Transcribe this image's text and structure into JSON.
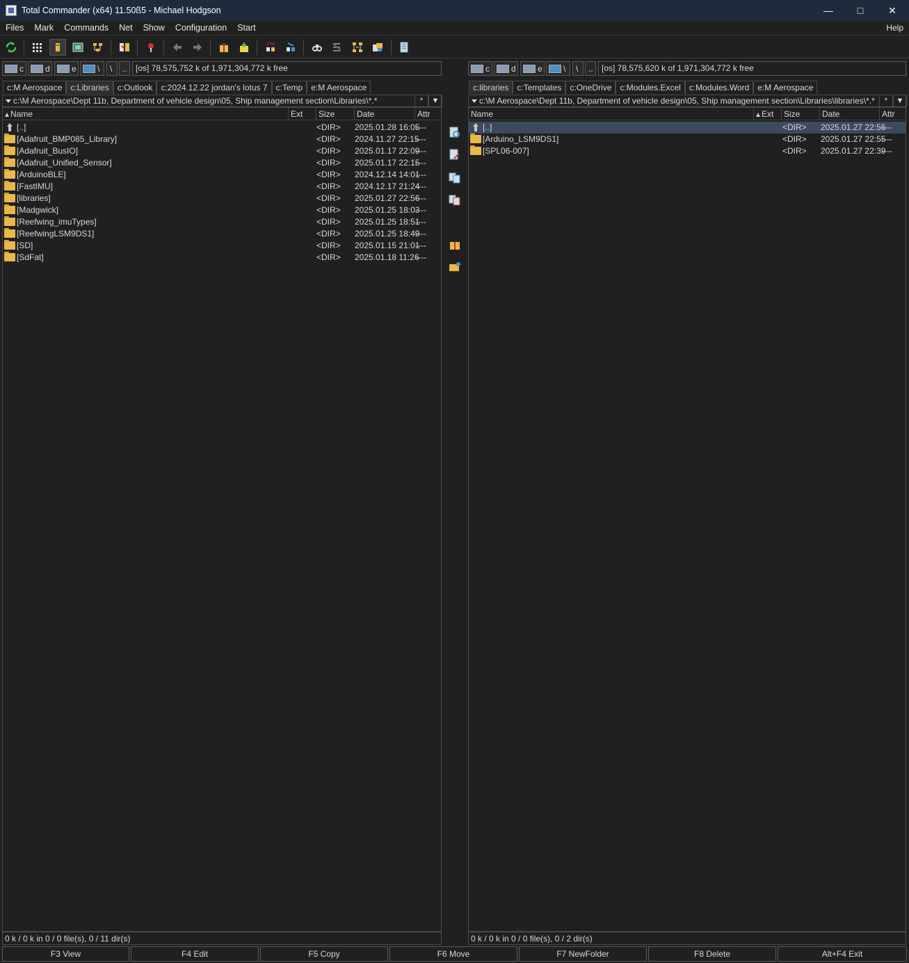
{
  "window": {
    "title": "Total Commander (x64) 11.50ß5 - Michael Hodgson",
    "minimize_glyph": "—",
    "maximize_glyph": "□",
    "close_glyph": "✕"
  },
  "menu": {
    "items": [
      "Files",
      "Mark",
      "Commands",
      "Net",
      "Show",
      "Configuration",
      "Start"
    ],
    "help": "Help"
  },
  "toolbar": {
    "icons": [
      "refresh-icon",
      "brief-view-icon",
      "detailed-view-icon",
      "thumbnails-icon",
      "tree-view-icon",
      "compare-dirs-icon",
      "multi-rename-icon",
      "back-icon",
      "forward-icon",
      "pack-icon",
      "unpack-icon",
      "ftp-connect-icon",
      "ftp-disconnect-icon",
      "find-icon",
      "sync-dirs-icon",
      "branch-view-icon",
      "copy-names-icon",
      "notepad-icon"
    ]
  },
  "left": {
    "drives": [
      {
        "letter": "c"
      },
      {
        "letter": "d"
      },
      {
        "letter": "e"
      },
      {
        "letter": "\\"
      }
    ],
    "root_label": "\\",
    "up_label": "..",
    "free_info": "[os]  78,575,752 k of 1,971,304,772 k free",
    "tabs": [
      "c:M Aerospace",
      "c:Libraries",
      "c:Outlook",
      "c:2024.12.22 jordan's lotus 7",
      "c:Temp",
      "e:M Aerospace"
    ],
    "active_tab": 1,
    "path": "c:\\M Aerospace\\Dept 11b, Department of vehicle design\\05, Ship management section\\Libraries\\*.*",
    "columns": {
      "name": "Name",
      "ext": "Ext",
      "size": "Size",
      "date": "Date",
      "attr": "Attr"
    },
    "rows": [
      {
        "name": "[..]",
        "size": "<DIR>",
        "date": "2025.01.28 16:05",
        "attr": "----",
        "up": true
      },
      {
        "name": "[Adafruit_BMP085_Library]",
        "size": "<DIR>",
        "date": "2024.11.27 22:15",
        "attr": "----"
      },
      {
        "name": "[Adafruit_BusIO]",
        "size": "<DIR>",
        "date": "2025.01.17 22:09",
        "attr": "----"
      },
      {
        "name": "[Adafruit_Unified_Sensor]",
        "size": "<DIR>",
        "date": "2025.01.17 22:15",
        "attr": "----"
      },
      {
        "name": "[ArduinoBLE]",
        "size": "<DIR>",
        "date": "2024.12.14 14:01",
        "attr": "----"
      },
      {
        "name": "[FastIMU]",
        "size": "<DIR>",
        "date": "2024.12.17 21:24",
        "attr": "----"
      },
      {
        "name": "[libraries]",
        "size": "<DIR>",
        "date": "2025.01.27 22:56",
        "attr": "----"
      },
      {
        "name": "[Madgwick]",
        "size": "<DIR>",
        "date": "2025.01.25 18:03",
        "attr": "----"
      },
      {
        "name": "[Reefwing_imuTypes]",
        "size": "<DIR>",
        "date": "2025.01.25 18:51",
        "attr": "----"
      },
      {
        "name": "[ReefwingLSM9DS1]",
        "size": "<DIR>",
        "date": "2025.01.25 18:49",
        "attr": "----"
      },
      {
        "name": "[SD]",
        "size": "<DIR>",
        "date": "2025.01.15 21:01",
        "attr": "----"
      },
      {
        "name": "[SdFat]",
        "size": "<DIR>",
        "date": "2025.01.18 11:26",
        "attr": "----"
      }
    ],
    "status": "0 k / 0 k in 0 / 0 file(s), 0 / 11 dir(s)"
  },
  "right": {
    "drives": [
      {
        "letter": "c"
      },
      {
        "letter": "d"
      },
      {
        "letter": "e"
      },
      {
        "letter": "\\"
      }
    ],
    "root_label": "\\",
    "up_label": "..",
    "free_info": "[os]  78,575,620 k of 1,971,304,772 k free",
    "tabs": [
      "c:libraries",
      "c:Templates",
      "c:OneDrive",
      "c:Modules.Excel",
      "c:Modules.Word",
      "e:M Aerospace"
    ],
    "active_tab": 0,
    "path": "c:\\M Aerospace\\Dept 11b, Department of vehicle design\\05, Ship management section\\Libraries\\libraries\\*.*",
    "columns": {
      "name": "Name",
      "ext": "Ext",
      "size": "Size",
      "date": "Date",
      "attr": "Attr"
    },
    "rows": [
      {
        "name": "[..]",
        "size": "<DIR>",
        "date": "2025.01.27 22:56",
        "attr": "----",
        "up": true
      },
      {
        "name": "[Arduino_LSM9DS1]",
        "size": "<DIR>",
        "date": "2025.01.27 22:55",
        "attr": "----"
      },
      {
        "name": "[SPL06-007]",
        "size": "<DIR>",
        "date": "2025.01.27 22:39",
        "attr": "----"
      }
    ],
    "status": "0 k / 0 k in 0 / 0 file(s), 0 / 2 dir(s)"
  },
  "path_buttons": {
    "star": "*",
    "history": "▼"
  },
  "middle_icons": [
    "view-file-icon",
    "edit-file-icon",
    "copy-file-icon",
    "move-file-icon",
    "pack-files-icon",
    "new-folder-icon"
  ],
  "fkeys": [
    "F3 View",
    "F4 Edit",
    "F5 Copy",
    "F6 Move",
    "F7 NewFolder",
    "F8 Delete",
    "Alt+F4 Exit"
  ]
}
